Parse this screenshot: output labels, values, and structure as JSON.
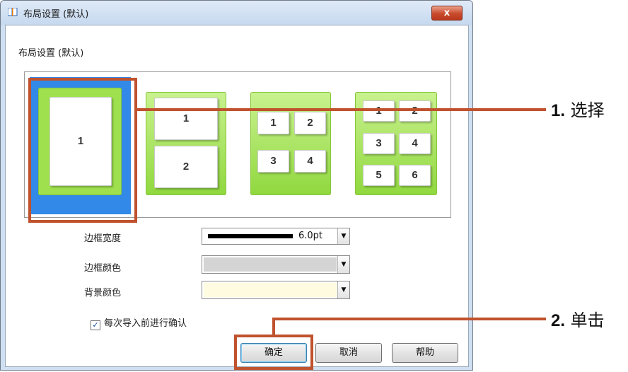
{
  "window": {
    "title": "布局设置 (默认)",
    "close_label": "x"
  },
  "group_label": "布局设置 (默认)",
  "layouts": [
    {
      "name": "one-page",
      "pages": [
        "1"
      ],
      "selected": true
    },
    {
      "name": "two-pages",
      "pages": [
        "1",
        "2"
      ],
      "selected": false
    },
    {
      "name": "four-pages",
      "pages": [
        "1",
        "2",
        "3",
        "4"
      ],
      "selected": false
    },
    {
      "name": "six-pages",
      "pages": [
        "1",
        "2",
        "3",
        "4",
        "5",
        "6"
      ],
      "selected": false
    }
  ],
  "fields": {
    "border_width": {
      "label": "边框宽度",
      "value": "6.0pt"
    },
    "border_color": {
      "label": "边框颜色",
      "value": "",
      "color": "#d4d4d4"
    },
    "background_color": {
      "label": "背景颜色",
      "value": "",
      "color": "#fefbe0"
    }
  },
  "confirm_checkbox": {
    "label": "每次导入前进行确认",
    "checked": true
  },
  "buttons": {
    "ok": "确定",
    "cancel": "取消",
    "help": "帮助"
  },
  "callouts": [
    {
      "number": "1.",
      "text": "选择"
    },
    {
      "number": "2.",
      "text": "单击"
    }
  ],
  "colors": {
    "accent": "#c0522d",
    "selection": "#3389e8",
    "thumbnail_green": "#9ee04e"
  }
}
